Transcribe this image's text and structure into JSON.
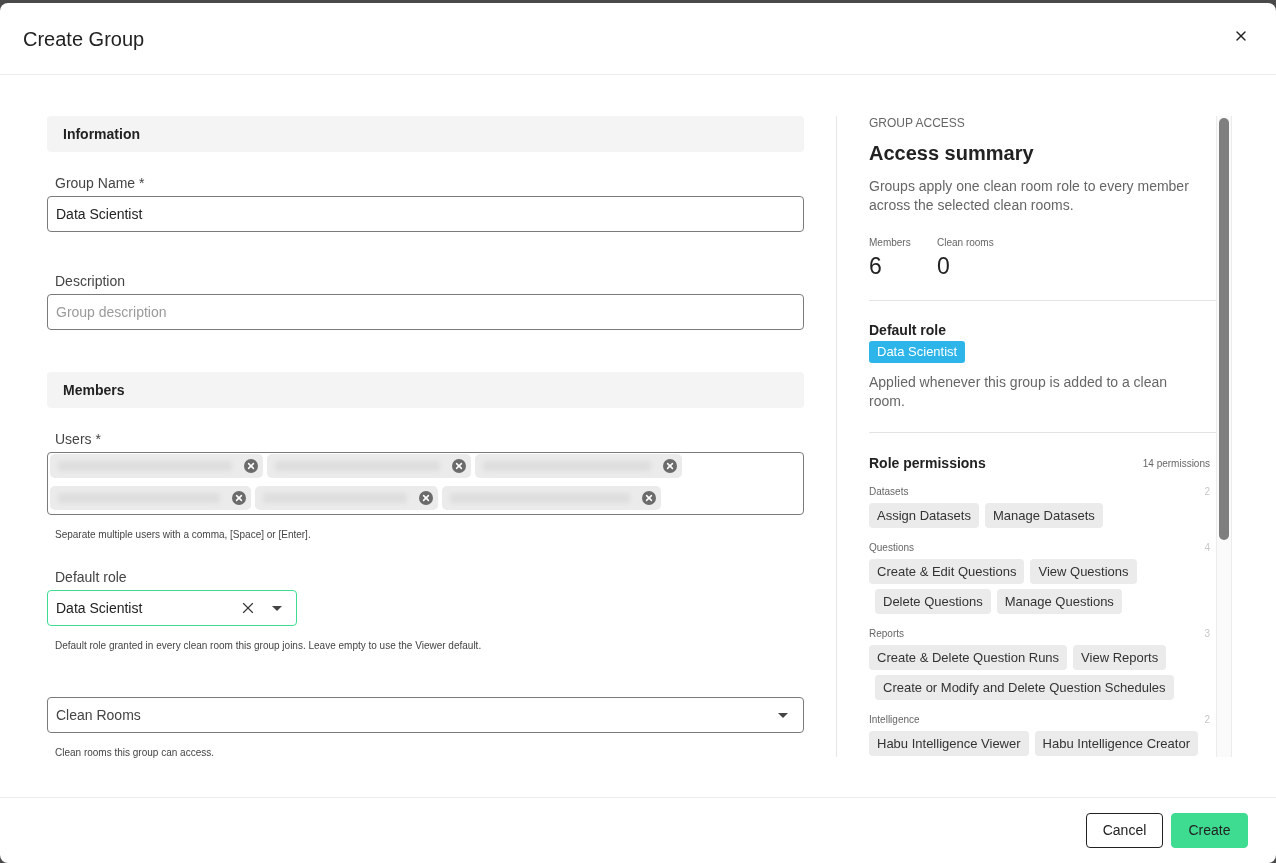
{
  "dialog": {
    "title": "Create Group"
  },
  "information": {
    "heading": "Information",
    "group_name": {
      "label": "Group Name *",
      "value": "Data Scientist"
    },
    "description": {
      "label": "Description",
      "placeholder": "Group description"
    }
  },
  "members": {
    "heading": "Members",
    "users": {
      "label": "Users *",
      "chips": [
        {
          "kind": "redacted"
        },
        {
          "kind": "redacted"
        },
        {
          "kind": "redacted"
        },
        {
          "kind": "redacted"
        },
        {
          "kind": "redacted"
        },
        {
          "kind": "redacted"
        }
      ],
      "helper": "Separate multiple users with a comma, [Space] or [Enter]."
    },
    "default_role": {
      "label": "Default role",
      "value": "Data Scientist",
      "focused": true,
      "helper": "Default role granted in every clean room this group joins. Leave empty to use the Viewer default."
    },
    "clean_rooms": {
      "label": "Clean Rooms",
      "helper": "Clean rooms this group can access."
    }
  },
  "access_summary": {
    "eyebrow": "GROUP ACCESS",
    "title": "Access summary",
    "description": "Groups apply one clean room role to every member across the selected clean rooms.",
    "stats": [
      {
        "label": "Members",
        "value": "6"
      },
      {
        "label": "Clean rooms",
        "value": "0"
      }
    ],
    "default_role": {
      "heading": "Default role",
      "badge": "Data Scientist",
      "note": "Applied whenever this group is added to a clean room."
    },
    "permissions": {
      "heading": "Role permissions",
      "count": "14 permissions",
      "categories": [
        {
          "name": "Datasets",
          "count": "2",
          "items": [
            "Assign Datasets",
            "Manage Datasets"
          ]
        },
        {
          "name": "Questions",
          "count": "4",
          "items": [
            "Create & Edit Questions",
            "View Questions",
            "Delete Questions",
            "Manage Questions"
          ]
        },
        {
          "name": "Reports",
          "count": "3",
          "items": [
            "Create & Delete Question Runs",
            "View Reports",
            "Create or Modify and Delete Question Schedules"
          ]
        },
        {
          "name": "Intelligence",
          "count": "2",
          "items": [
            "Habu Intelligence Viewer",
            "Habu Intelligence Creator"
          ]
        }
      ]
    }
  },
  "footer": {
    "buttons": [
      {
        "label": "Cancel",
        "kind": "secondary"
      },
      {
        "label": "Create",
        "kind": "primary"
      }
    ]
  }
}
